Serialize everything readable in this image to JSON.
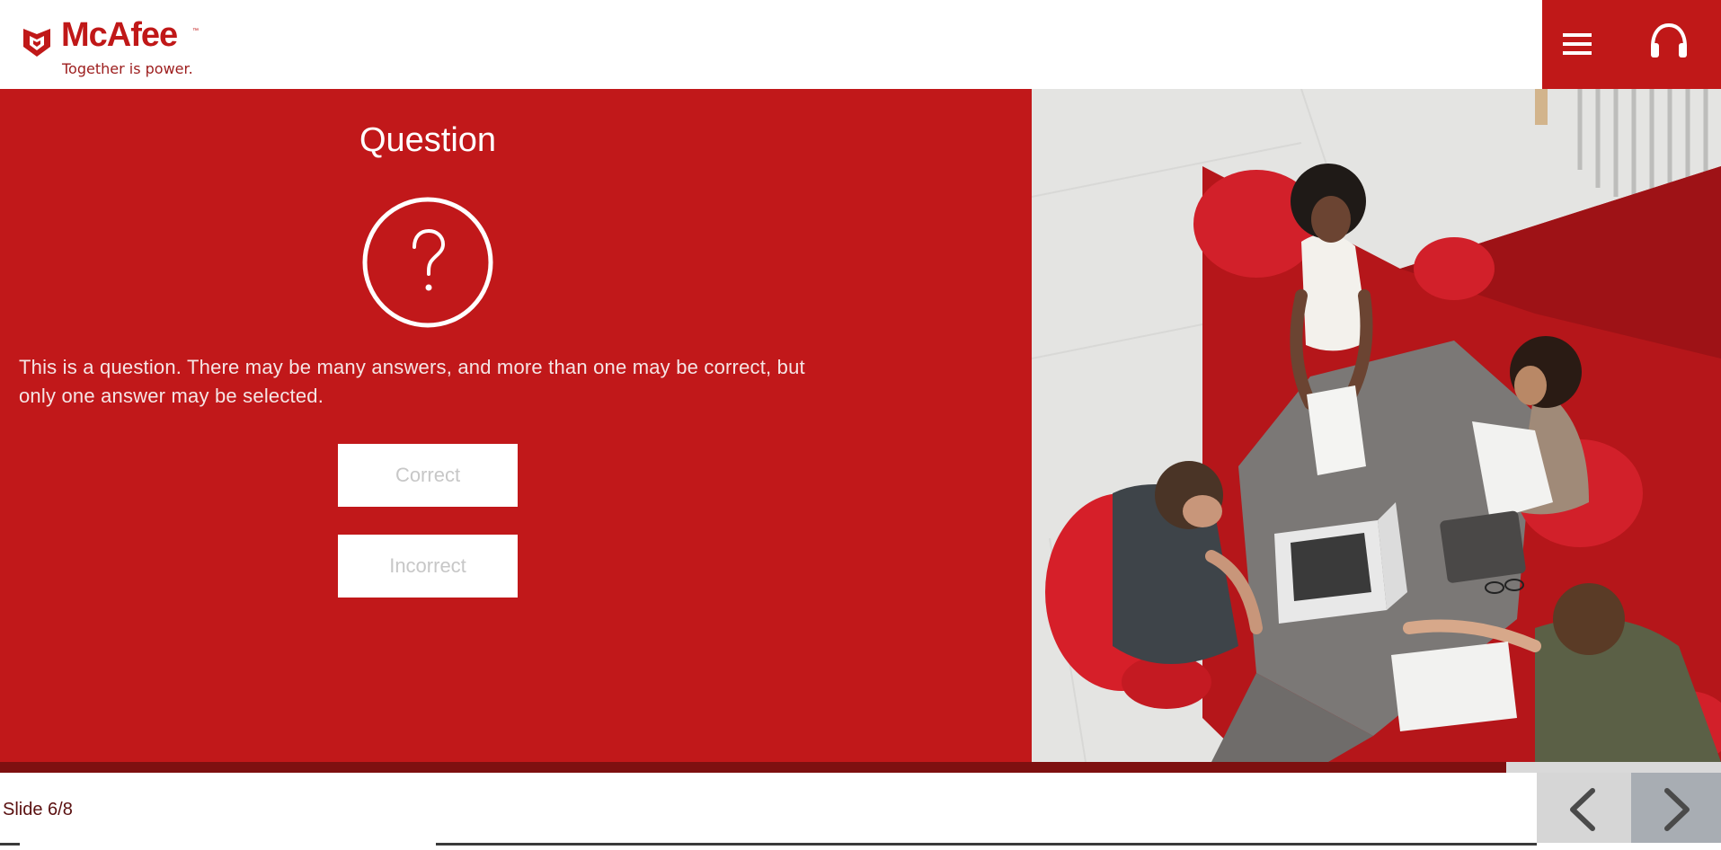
{
  "brand": {
    "name": "McAfee",
    "trademark": "™",
    "tagline": "Together is power.",
    "color": "#c01818"
  },
  "header": {
    "menu_icon": "hamburger-menu-icon",
    "audio_icon": "headphones-icon"
  },
  "question": {
    "title": "Question",
    "icon": "question-mark-icon",
    "text": "This is a question. There may be many answers, and more than one may be correct, but only one answer may be selected.",
    "answers": [
      {
        "label": "Correct"
      },
      {
        "label": "Incorrect"
      }
    ]
  },
  "photo": {
    "subject": "team-meeting-photo"
  },
  "footer": {
    "slide_counter": "Slide 6/8",
    "progress_fraction": 0.875,
    "prev_icon": "chevron-left-icon",
    "next_icon": "chevron-right-icon"
  },
  "colors": {
    "panel_red": "#c1181a",
    "progress": "#7e1010"
  }
}
